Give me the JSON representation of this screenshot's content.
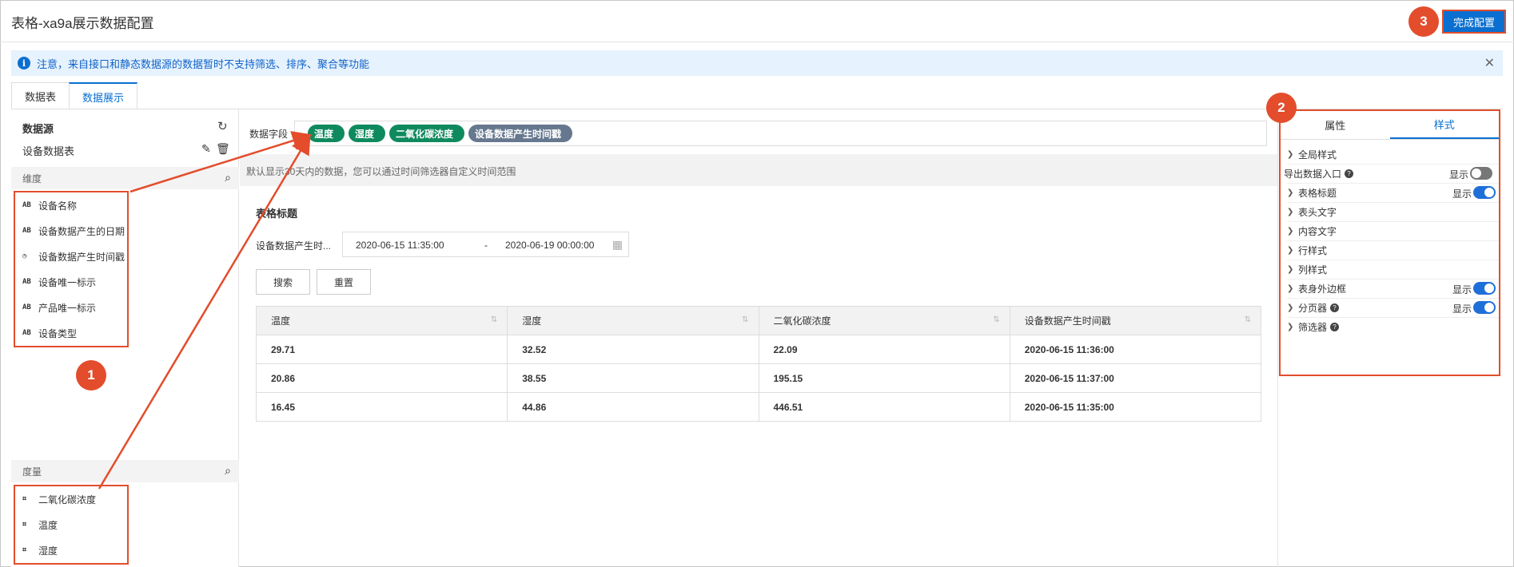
{
  "header": {
    "title": "表格-xa9a展示数据配置",
    "done_label": "完成配置"
  },
  "notice": {
    "text": "注意，来自接口和静态数据源的数据暂时不支持筛选、排序、聚合等功能",
    "close": "✕"
  },
  "tabs": [
    "数据表",
    "数据展示"
  ],
  "left": {
    "datasource_title": "数据源",
    "datasource_name": "设备数据表",
    "dimension_title": "维度",
    "dimensions": [
      {
        "type": "AB",
        "label": "设备名称"
      },
      {
        "type": "AB",
        "label": "设备数据产生的日期"
      },
      {
        "type": "◷",
        "label": "设备数据产生时间戳"
      },
      {
        "type": "AB",
        "label": "设备唯一标示"
      },
      {
        "type": "AB",
        "label": "产品唯一标示"
      },
      {
        "type": "AB",
        "label": "设备类型"
      }
    ],
    "measure_title": "度量",
    "measures": [
      {
        "type": "⌗",
        "label": "二氧化碳浓度"
      },
      {
        "type": "⌗",
        "label": "温度"
      },
      {
        "type": "⌗",
        "label": "湿度"
      }
    ]
  },
  "center": {
    "data_field_label": "数据字段",
    "chips": [
      "温度",
      "湿度",
      "二氧化碳浓度",
      "设备数据产生时间戳"
    ],
    "hint": "默认显示30天内的数据，您可以通过时间筛选器自定义时间范围",
    "table_title": "表格标题",
    "filter_label": "设备数据产生时...",
    "date_start": "2020-06-15 11:35:00",
    "date_sep": "-",
    "date_end": "2020-06-19 00:00:00",
    "search_label": "搜索",
    "reset_label": "重置",
    "columns": [
      "温度",
      "湿度",
      "二氧化碳浓度",
      "设备数据产生时间戳"
    ],
    "rows": [
      [
        "29.71",
        "32.52",
        "22.09",
        "2020-06-15 11:36:00"
      ],
      [
        "20.86",
        "38.55",
        "195.15",
        "2020-06-15 11:37:00"
      ],
      [
        "16.45",
        "44.86",
        "446.51",
        "2020-06-15 11:35:00"
      ]
    ]
  },
  "right": {
    "tabs": [
      "属性",
      "样式"
    ],
    "rows": [
      {
        "label": "全局样式",
        "chevron": true
      },
      {
        "label": "导出数据入口",
        "chevron": false,
        "help": true,
        "show": "显示",
        "toggle": false
      },
      {
        "label": "表格标题",
        "chevron": true,
        "show": "显示",
        "toggle": true
      },
      {
        "label": "表头文字",
        "chevron": true
      },
      {
        "label": "内容文字",
        "chevron": true
      },
      {
        "label": "行样式",
        "chevron": true
      },
      {
        "label": "列样式",
        "chevron": true
      },
      {
        "label": "表身外边框",
        "chevron": true,
        "show": "显示",
        "toggle": true
      },
      {
        "label": "分页器",
        "chevron": true,
        "help": true,
        "show": "显示",
        "toggle": true
      },
      {
        "label": "筛选器",
        "chevron": true,
        "help": true
      }
    ]
  },
  "badges": [
    "1",
    "2",
    "3"
  ],
  "colors": {
    "accent": "#0a6fd0",
    "annotation": "#e34d2c",
    "chip_green": "#0f8a5f",
    "chip_gray": "#66788f"
  }
}
